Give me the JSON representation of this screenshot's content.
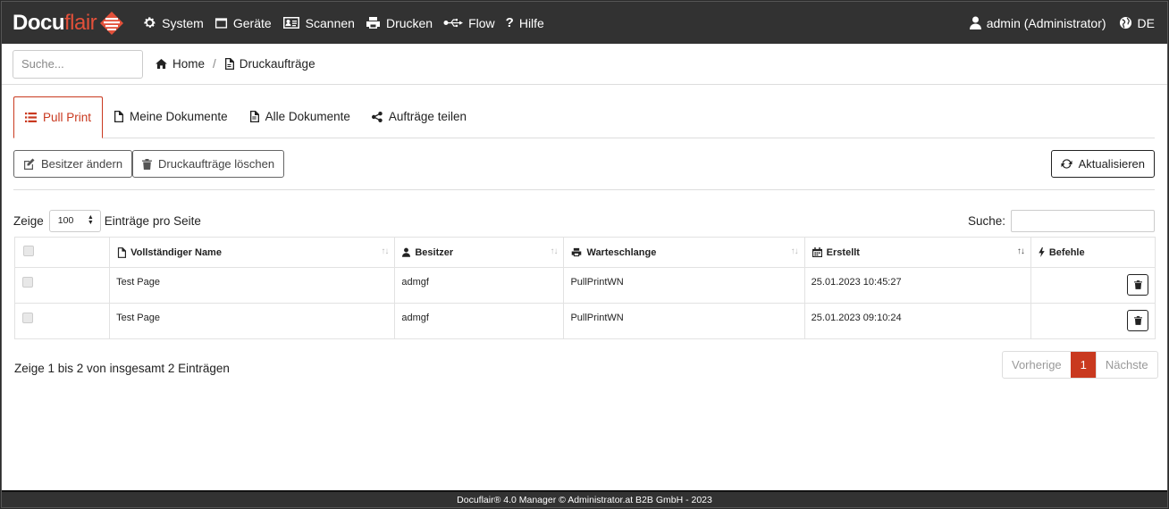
{
  "brand": {
    "part1": "Docu",
    "part2": "flair"
  },
  "nav": {
    "items": [
      {
        "label": "System",
        "icon": "gear-icon"
      },
      {
        "label": "Geräte",
        "icon": "window-icon"
      },
      {
        "label": "Scannen",
        "icon": "id-card-icon"
      },
      {
        "label": "Drucken",
        "icon": "printer-icon"
      },
      {
        "label": "Flow",
        "icon": "usb-icon"
      },
      {
        "label": "Hilfe",
        "icon": "question-icon"
      }
    ],
    "user": "admin (Administrator)",
    "language": "DE"
  },
  "search": {
    "placeholder": "Suche..."
  },
  "breadcrumb": {
    "home": "Home",
    "current": "Druckaufträge"
  },
  "tabs": [
    {
      "label": "Pull Print",
      "active": true
    },
    {
      "label": "Meine Dokumente"
    },
    {
      "label": "Alle Dokumente"
    },
    {
      "label": "Aufträge teilen"
    }
  ],
  "actions": {
    "change_owner": "Besitzer ändern",
    "delete_jobs": "Druckaufträge löschen",
    "refresh": "Aktualisieren"
  },
  "table_controls": {
    "show_label": "Zeige",
    "page_size": "100",
    "per_page_label": "Einträge pro Seite",
    "search_label": "Suche:"
  },
  "table": {
    "headers": {
      "name": "Vollständiger Name",
      "owner": "Besitzer",
      "queue": "Warteschlange",
      "created": "Erstellt",
      "commands": "Befehle"
    },
    "rows": [
      {
        "name": "Test Page",
        "owner": "admgf",
        "queue": "PullPrintWN",
        "created": "25.01.2023 10:45:27"
      },
      {
        "name": "Test Page",
        "owner": "admgf",
        "queue": "PullPrintWN",
        "created": "25.01.2023 09:10:24"
      }
    ]
  },
  "info": "Zeige 1 bis 2 von insgesamt 2 Einträgen",
  "pager": {
    "prev": "Vorherige",
    "current": "1",
    "next": "Nächste"
  },
  "footer": "Docuflair® 4.0 Manager © Administrator.at B2B GmbH - 2023",
  "colors": {
    "accent": "#c9391f",
    "navbar": "#323232"
  }
}
